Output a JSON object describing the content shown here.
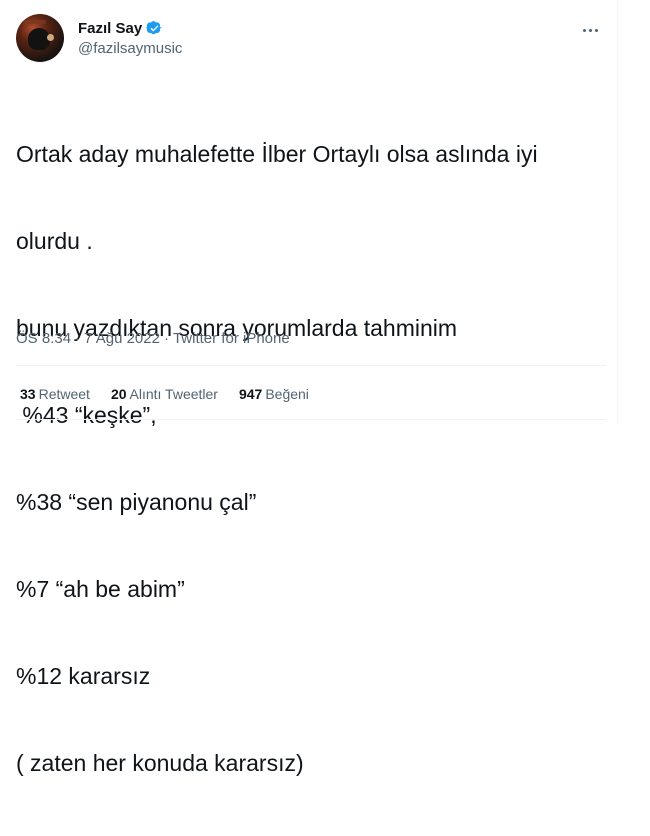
{
  "author": {
    "display_name": "Fazıl Say",
    "handle": "@fazilsaymusic",
    "verified_color": "#1d9bf0"
  },
  "tweet": {
    "lines": [
      "Ortak aday muhalefette İlber Ortaylı olsa aslında iyi",
      "olurdu .",
      "bunu yazdıktan sonra yorumlarda tahminim",
      " %43 “keşke”,",
      "%38 “sen piyanonu çal”",
      "%7 “ah be abim”",
      "%12 kararsız",
      "( zaten her konuda kararsız)"
    ]
  },
  "meta": {
    "time": "ÖS 8:34",
    "separator": "·",
    "date": "7 Ağu 2022",
    "source": "Twitter for iPhone"
  },
  "stats": {
    "retweets": {
      "count": "33",
      "label": "Retweet"
    },
    "quotes": {
      "count": "20",
      "label": "Alıntı Tweetler"
    },
    "likes": {
      "count": "947",
      "label": "Beğeni"
    }
  },
  "icons": {
    "verified": "verified-badge-icon",
    "more": "more-horizontal-icon"
  }
}
